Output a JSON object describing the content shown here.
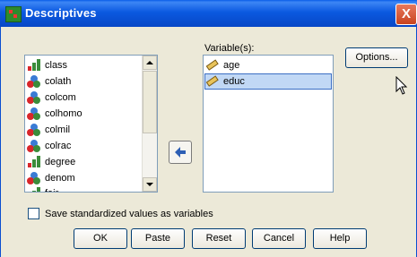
{
  "window": {
    "title": "Descriptives",
    "close_label": "X"
  },
  "source_list": {
    "items": [
      {
        "label": "class",
        "type": "ordinal"
      },
      {
        "label": "colath",
        "type": "nominal"
      },
      {
        "label": "colcom",
        "type": "nominal"
      },
      {
        "label": "colhomo",
        "type": "nominal"
      },
      {
        "label": "colmil",
        "type": "nominal"
      },
      {
        "label": "colrac",
        "type": "nominal"
      },
      {
        "label": "degree",
        "type": "ordinal"
      },
      {
        "label": "denom",
        "type": "nominal"
      },
      {
        "label": "fair",
        "type": "ordinal"
      }
    ]
  },
  "target": {
    "label": "Variable(s):",
    "items": [
      {
        "label": "age",
        "type": "scale",
        "selected": false
      },
      {
        "label": "educ",
        "type": "scale",
        "selected": true
      }
    ]
  },
  "checkbox": {
    "label": "Save standardized values as variables",
    "checked": false
  },
  "buttons": {
    "options": "Options...",
    "ok": "OK",
    "paste": "Paste",
    "reset": "Reset",
    "cancel": "Cancel",
    "help": "Help"
  },
  "colors": {
    "titlebar": "#0b59e0",
    "selection": "#c1d8f5",
    "dialog_bg": "#ece9d8"
  }
}
